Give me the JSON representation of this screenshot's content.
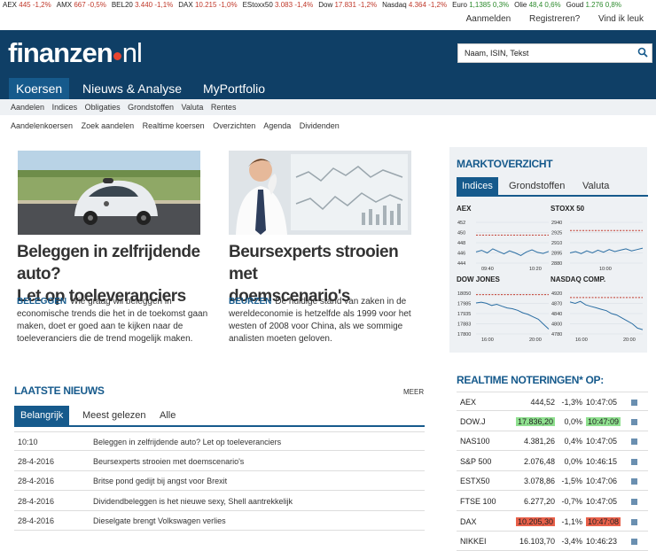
{
  "ticker": [
    {
      "name": "AEX",
      "value": "445",
      "chg": "-1,2%",
      "dir": "neg"
    },
    {
      "name": "AMX",
      "value": "667",
      "chg": "-0,5%",
      "dir": "neg"
    },
    {
      "name": "BEL20",
      "value": "3.440",
      "chg": "-1,1%",
      "dir": "neg"
    },
    {
      "name": "DAX",
      "value": "10.215",
      "chg": "-1,0%",
      "dir": "neg"
    },
    {
      "name": "EStoxx50",
      "value": "3.083",
      "chg": "-1,4%",
      "dir": "neg"
    },
    {
      "name": "Dow",
      "value": "17.831",
      "chg": "-1,2%",
      "dir": "neg"
    },
    {
      "name": "Nasdaq",
      "value": "4.364",
      "chg": "-1,2%",
      "dir": "neg"
    },
    {
      "name": "Euro",
      "value": "1,1385",
      "chg": "0,3%",
      "dir": "pos"
    },
    {
      "name": "Olie",
      "value": "48,4",
      "chg": "0,6%",
      "dir": "pos"
    },
    {
      "name": "Goud",
      "value": "1.276",
      "chg": "0,8%",
      "dir": "pos"
    }
  ],
  "toplinks": {
    "login": "Aanmelden",
    "register": "Registreren?",
    "like": "Vind ik leuk"
  },
  "logo": {
    "text1": "finanzen",
    "text2": "nl"
  },
  "search": {
    "value": "Naam, ISIN, Tekst"
  },
  "mainnav": [
    "Koersen",
    "Nieuws & Analyse",
    "MyPortfolio"
  ],
  "subnav1": [
    "Aandelen",
    "Indices",
    "Obligaties",
    "Grondstoffen",
    "Valuta",
    "Rentes"
  ],
  "subnav2": [
    "Aandelenkoersen",
    "Zoek aandelen",
    "Realtime koersen",
    "Overzichten",
    "Agenda",
    "Dividenden"
  ],
  "articles": [
    {
      "title1": "Beleggen in zelfrijdende auto?",
      "title2": "Let op toeleveranciers",
      "tag": "BELEGGEN",
      "text": "Wie graag wil beleggen in economische trends die het in de toekomst gaan maken, doet er goed aan te kijken naar de toeleveranciers die de trend mogelijk maken."
    },
    {
      "title1": "Beursexperts strooien met",
      "title2": "doemscenario's",
      "tag": "BEURZEN",
      "text": "De huidige stand van zaken in de wereldeconomie is hetzelfde als 1999 voor het westen of 2008 voor China, als we sommige analisten moeten geloven."
    }
  ],
  "laatste": {
    "title": "LAATSTE NIEUWS",
    "more": "MEER",
    "tabs": [
      "Belangrijk",
      "Meest gelezen",
      "Alle"
    ],
    "rows": [
      {
        "date": "10:10",
        "title": "Beleggen in zelfrijdende auto? Let op toeleveranciers"
      },
      {
        "date": "28-4-2016",
        "title": "Beursexperts strooien met doemscenario's"
      },
      {
        "date": "28-4-2016",
        "title": "Britse pond gedijt bij angst voor Brexit"
      },
      {
        "date": "28-4-2016",
        "title": "Dividendbeleggen is het nieuwe sexy, Shell aantrekkelijk"
      },
      {
        "date": "28-4-2016",
        "title": "Dieselgate brengt Volkswagen verlies"
      }
    ]
  },
  "markt": {
    "title": "MARKTOVERZICHT",
    "tabs": [
      "Indices",
      "Grondstoffen",
      "Valuta"
    ],
    "charts": [
      {
        "name": "AEX",
        "yticks": [
          "452",
          "450",
          "448",
          "446",
          "444"
        ],
        "xticks": [
          "09:40",
          "10:20"
        ]
      },
      {
        "name": "STOXX 50",
        "yticks": [
          "2940",
          "2925",
          "2910",
          "2895",
          "2880"
        ],
        "xticks": [
          "10:00"
        ]
      },
      {
        "name": "DOW JONES",
        "yticks": [
          "18050",
          "17985",
          "17935",
          "17883",
          "17800"
        ],
        "xticks": [
          "16:00",
          "20:00"
        ]
      },
      {
        "name": "NASDAQ COMP.",
        "yticks": [
          "4920",
          "4870",
          "4840",
          "4800",
          "4780"
        ],
        "xticks": [
          "16:00",
          "20:00"
        ]
      }
    ]
  },
  "chart_data": [
    {
      "type": "line",
      "title": "AEX",
      "yticks": [
        "452",
        "450",
        "448",
        "446",
        "444"
      ],
      "x": [
        "09:40",
        "10:20"
      ],
      "series": [
        {
          "values": [
            446.2,
            446.5,
            446.0,
            446.8,
            446.3,
            445.8,
            446.4,
            446.0,
            445.5,
            446.2,
            446.6,
            446.1,
            445.9,
            446.3
          ]
        }
      ],
      "reference": 449.5,
      "ylim": [
        444,
        452
      ]
    },
    {
      "type": "line",
      "title": "STOXX 50",
      "yticks": [
        "2940",
        "2925",
        "2910",
        "2895",
        "2880"
      ],
      "x": [
        "10:00"
      ],
      "series": [
        {
          "values": [
            2895,
            2897,
            2894,
            2898,
            2895,
            2899,
            2896,
            2900,
            2897,
            2899,
            2901,
            2898,
            2900,
            2902
          ]
        }
      ],
      "reference": 2928,
      "ylim": [
        2880,
        2940
      ]
    },
    {
      "type": "line",
      "title": "DOW JONES",
      "yticks": [
        "18050",
        "17985",
        "17935",
        "17883",
        "17800"
      ],
      "x": [
        "16:00",
        "20:00"
      ],
      "series": [
        {
          "values": [
            17990,
            17995,
            17988,
            17975,
            17982,
            17970,
            17960,
            17955,
            17945,
            17930,
            17920,
            17905,
            17890,
            17860,
            17830
          ]
        }
      ],
      "reference": 18041,
      "ylim": [
        17800,
        18050
      ]
    },
    {
      "type": "line",
      "title": "NASDAQ COMP.",
      "yticks": [
        "4920",
        "4870",
        "4840",
        "4800",
        "4780"
      ],
      "x": [
        "16:00",
        "20:00"
      ],
      "series": [
        {
          "values": [
            4890,
            4885,
            4892,
            4880,
            4875,
            4870,
            4865,
            4860,
            4850,
            4845,
            4835,
            4825,
            4815,
            4800,
            4795
          ]
        }
      ],
      "reference": 4905,
      "ylim": [
        4780,
        4920
      ]
    }
  ],
  "realtime": {
    "title": "REALTIME NOTERINGEN* OP:",
    "rows": [
      {
        "name": "AEX",
        "value": "444,52",
        "chg": "-1,3%",
        "time": "10:47:05",
        "hl": ""
      },
      {
        "name": "DOW.J",
        "value": "17.836,20",
        "chg": "0,0%",
        "time": "10:47:09",
        "hl": "g"
      },
      {
        "name": "NAS100",
        "value": "4.381,26",
        "chg": "0,4%",
        "time": "10:47:05",
        "hl": ""
      },
      {
        "name": "S&P 500",
        "value": "2.076,48",
        "chg": "0,0%",
        "time": "10:46:15",
        "hl": ""
      },
      {
        "name": "ESTX50",
        "value": "3.078,86",
        "chg": "-1,5%",
        "time": "10:47:06",
        "hl": ""
      },
      {
        "name": "FTSE 100",
        "value": "6.277,20",
        "chg": "-0,7%",
        "time": "10:47:05",
        "hl": ""
      },
      {
        "name": "DAX",
        "value": "10.205,30",
        "chg": "-1,1%",
        "time": "10:47:08",
        "hl": "r"
      },
      {
        "name": "NIKKEI",
        "value": "16.103,70",
        "chg": "-3,4%",
        "time": "10:46:23",
        "hl": ""
      }
    ]
  }
}
